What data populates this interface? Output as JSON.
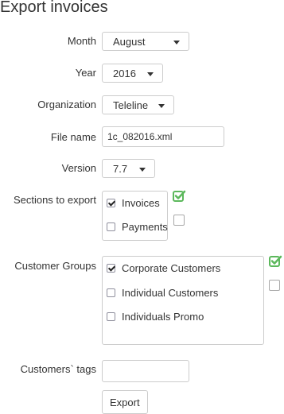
{
  "page": {
    "title": "Export invoices"
  },
  "form": {
    "month": {
      "label": "Month",
      "value": "August"
    },
    "year": {
      "label": "Year",
      "value": "2016"
    },
    "organization": {
      "label": "Organization",
      "value": "Teleline"
    },
    "file_name": {
      "label": "File name",
      "value": "1c_082016.xml"
    },
    "version": {
      "label": "Version",
      "value": "7.7"
    },
    "sections": {
      "label": "Sections to export",
      "items": [
        {
          "label": "Invoices",
          "checked": true
        },
        {
          "label": "Payments",
          "checked": false
        }
      ],
      "toggles": [
        {
          "icon": "checked-checkbox-icon",
          "state": "checked",
          "color": "#5cb85c"
        },
        {
          "icon": "unchecked-checkbox-icon",
          "state": "unchecked"
        }
      ]
    },
    "customer_groups": {
      "label": "Customer Groups",
      "items": [
        {
          "label": "Corporate Customers",
          "checked": true
        },
        {
          "label": "Individual Customers",
          "checked": false
        },
        {
          "label": "Individuals Promo",
          "checked": false
        }
      ],
      "toggles": [
        {
          "icon": "checked-checkbox-icon",
          "state": "checked",
          "color": "#5cb85c"
        },
        {
          "icon": "unchecked-checkbox-icon",
          "state": "unchecked"
        }
      ]
    },
    "customers_tags": {
      "label": "Customers` tags",
      "value": ""
    },
    "export_button": {
      "label": "Export"
    }
  }
}
